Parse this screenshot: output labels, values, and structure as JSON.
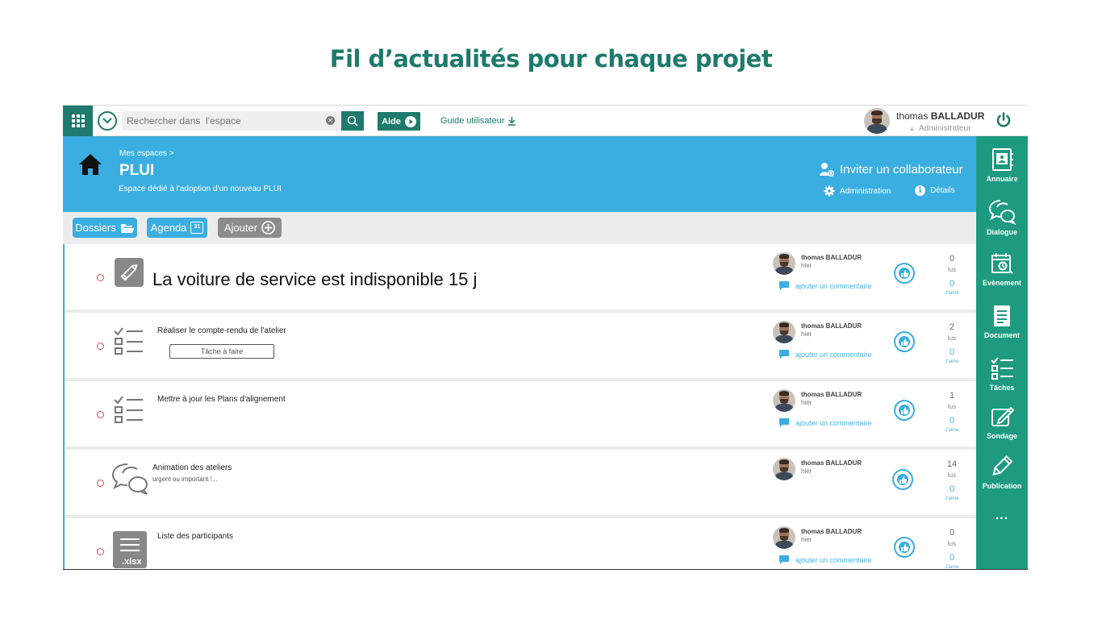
{
  "slide_title": "Fil d’actualités pour chaque projet",
  "topbar": {
    "search_placeholder": "Rechercher dans  l'espace",
    "aide_label": "Aide",
    "guide_label": "Guide utilisateur",
    "user_first": "thomas",
    "user_last": "BALLADUR",
    "user_role": "Administrateur"
  },
  "header": {
    "breadcrumb": "Mes espaces >",
    "space_title": "PLUI",
    "space_desc": "Espace dédié à l'adoption d'un nouveau PLUI",
    "invite_label": "Inviter un collaborateur",
    "admin_label": "Administration",
    "details_label": "Détails",
    "color": "#3aaee0"
  },
  "actions": {
    "dossiers": "Dossiers",
    "agenda": "Agenda",
    "agenda_day": "31",
    "ajouter": "Ajouter"
  },
  "sidebar": {
    "color": "#1d9a7f",
    "items": [
      {
        "label": "Annuaire",
        "icon": "contacts-book-icon"
      },
      {
        "label": "Dialogue",
        "icon": "chat-bubbles-icon"
      },
      {
        "label": "Evènement",
        "icon": "calendar-event-icon"
      },
      {
        "label": "Document",
        "icon": "document-icon"
      },
      {
        "label": "Tâches",
        "icon": "task-list-icon"
      },
      {
        "label": "Sondage",
        "icon": "poll-edit-icon"
      },
      {
        "label": "Publication",
        "icon": "pencil-icon"
      },
      {
        "label": "...",
        "icon": "more-icon"
      }
    ]
  },
  "feed": {
    "items": [
      {
        "type": "publication",
        "title": "La voiture de service est indisponible 15 j",
        "author": "thomas BALLADUR",
        "time": "hier",
        "comment": "ajouter un commentaire",
        "lus": "0",
        "lus_label": "lus",
        "likes": "0",
        "likes_label": "J'aime"
      },
      {
        "type": "task",
        "title": "Réaliser le compte-rendu de l'atelier",
        "field": "Tâche à faire",
        "author": "thomas BALLADUR",
        "time": "hier",
        "comment": "ajouter un commentaire",
        "lus": "2",
        "lus_label": "lus",
        "likes": "0",
        "likes_label": "J'aime"
      },
      {
        "type": "task",
        "title": "Mettre à jour les Plans d'alignement",
        "author": "thomas BALLADUR",
        "time": "hier",
        "comment": "ajouter un commentaire",
        "lus": "1",
        "lus_label": "lus",
        "likes": "0",
        "likes_label": "J'aime"
      },
      {
        "type": "dialogue",
        "title": "Animation des ateliers",
        "subtitle": "urgent ou important !...",
        "author": "thomas BALLADUR",
        "time": "hier",
        "lus": "14",
        "lus_label": "lus",
        "likes": "0",
        "likes_label": "J'aime"
      },
      {
        "type": "document",
        "title": "Liste des participants",
        "file_ext": ".xlsx",
        "author": "thomas BALLADUR",
        "time": "hier",
        "comment": "ajouter un commentaire",
        "lus": "0",
        "lus_label": "lus",
        "likes": "0",
        "likes_label": "J'aime"
      }
    ]
  }
}
